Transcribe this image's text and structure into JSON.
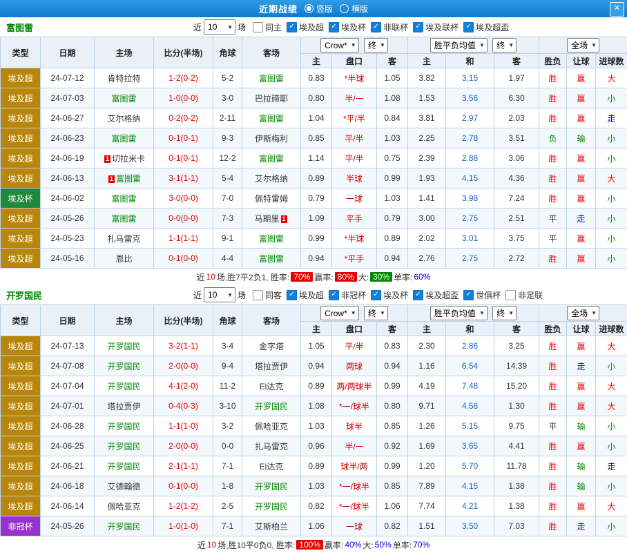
{
  "titlebar": {
    "title": "近期战绩",
    "layout_options": [
      {
        "label": "竖版",
        "selected": true
      },
      {
        "label": "横版",
        "selected": false
      }
    ],
    "close_label": "✕"
  },
  "table_header": {
    "cols": [
      "类型",
      "日期",
      "主场",
      "比分(半场)",
      "角球",
      "客场"
    ],
    "odds_dropdown": "Crow*",
    "odds_final_dropdown": "终",
    "odds_sub": [
      "主",
      "盘口",
      "客"
    ],
    "avg_dropdown": "胜平负均值",
    "avg_final_dropdown": "终",
    "avg_sub": [
      "主",
      "和",
      "客"
    ],
    "fullmatch_dropdown": "全场",
    "result_sub": [
      "胜负",
      "让球",
      "进球数"
    ]
  },
  "league_colors": {
    "埃及超": "#b8860b",
    "埃及杯": "#1e8a3c",
    "非冠杯": "#9932cc"
  },
  "value_colors": {
    "胜": "t-red",
    "负": "t-green",
    "平": "t-dark",
    "赢": "t-red",
    "输": "t-green",
    "走": "t-blue",
    "大": "t-red",
    "小": "t-green"
  },
  "sections": [
    {
      "team": "富图雷",
      "filter": {
        "near": "近",
        "count": "10",
        "unit": "场",
        "checkboxes": [
          {
            "label": "同主",
            "checked": false
          },
          {
            "label": "埃及超",
            "checked": true
          },
          {
            "label": "埃及杯",
            "checked": true
          },
          {
            "label": "非联杯",
            "checked": true
          },
          {
            "label": "埃及联杯",
            "checked": true
          },
          {
            "label": "埃及超盃",
            "checked": true
          }
        ]
      },
      "rows": [
        {
          "type": "埃及超",
          "date": "24-07-12",
          "home": {
            "name": "肯特拉特",
            "focus": false
          },
          "score": "1-2(0-2)",
          "corner": "5-2",
          "away": {
            "name": "富图雷",
            "focus": true
          },
          "odds": [
            "0.83",
            "*半球",
            "1.05"
          ],
          "avg": [
            "3.82",
            "3.15",
            "1.97"
          ],
          "result": [
            "胜",
            "赢",
            "大"
          ]
        },
        {
          "type": "埃及超",
          "date": "24-07-03",
          "home": {
            "name": "富图雷",
            "focus": true
          },
          "score": "1-0(0-0)",
          "corner": "3-0",
          "away": {
            "name": "巴拉碲耶",
            "focus": false
          },
          "odds": [
            "0.80",
            "半/一",
            "1.08"
          ],
          "avg": [
            "1.53",
            "3.56",
            "6.30"
          ],
          "result": [
            "胜",
            "赢",
            "小"
          ]
        },
        {
          "type": "埃及超",
          "date": "24-06-27",
          "home": {
            "name": "艾尔格纳",
            "focus": false
          },
          "score": "0-2(0-2)",
          "corner": "2-11",
          "away": {
            "name": "富图雷",
            "focus": true
          },
          "odds": [
            "1.04",
            "*平/半",
            "0.84"
          ],
          "avg": [
            "3.81",
            "2.97",
            "2.03"
          ],
          "result": [
            "胜",
            "赢",
            "走"
          ]
        },
        {
          "type": "埃及超",
          "date": "24-06-23",
          "home": {
            "name": "富图雷",
            "focus": true
          },
          "score": "0-1(0-1)",
          "corner": "9-3",
          "away": {
            "name": "伊斯梅利",
            "focus": false
          },
          "odds": [
            "0.85",
            "平/半",
            "1.03"
          ],
          "avg": [
            "2.25",
            "2.78",
            "3.51"
          ],
          "result": [
            "负",
            "输",
            "小"
          ]
        },
        {
          "type": "埃及超",
          "date": "24-06-19",
          "home": {
            "name": "切拉米卡",
            "focus": false,
            "badge": "1",
            "badge_pos": "left"
          },
          "score": "0-1(0-1)",
          "corner": "12-2",
          "away": {
            "name": "富图雷",
            "focus": true
          },
          "odds": [
            "1.14",
            "平/半",
            "0.75"
          ],
          "avg": [
            "2.39",
            "2.88",
            "3.06"
          ],
          "result": [
            "胜",
            "赢",
            "小"
          ]
        },
        {
          "type": "埃及超",
          "date": "24-06-13",
          "home": {
            "name": "富图雷",
            "focus": true,
            "badge": "1",
            "badge_pos": "left"
          },
          "score": "3-1(1-1)",
          "corner": "5-4",
          "away": {
            "name": "艾尔格纳",
            "focus": false
          },
          "odds": [
            "0.89",
            "半球",
            "0.99"
          ],
          "avg": [
            "1.93",
            "4.15",
            "4.36"
          ],
          "result": [
            "胜",
            "赢",
            "大"
          ]
        },
        {
          "type": "埃及杯",
          "date": "24-06-02",
          "home": {
            "name": "富图雷",
            "focus": true
          },
          "score": "3-0(0-0)",
          "corner": "7-0",
          "away": {
            "name": "佩特雷姆",
            "focus": false
          },
          "odds": [
            "0.79",
            "一球",
            "1.03"
          ],
          "avg": [
            "1.41",
            "3.98",
            "7.24"
          ],
          "result": [
            "胜",
            "赢",
            "小"
          ]
        },
        {
          "type": "埃及超",
          "date": "24-05-26",
          "home": {
            "name": "富图雷",
            "focus": true
          },
          "score": "0-0(0-0)",
          "corner": "7-3",
          "away": {
            "name": "马期里",
            "focus": false,
            "badge": "1",
            "badge_pos": "right"
          },
          "odds": [
            "1.09",
            "平手",
            "0.79"
          ],
          "avg": [
            "3.00",
            "2.75",
            "2.51"
          ],
          "result": [
            "平",
            "走",
            "小"
          ]
        },
        {
          "type": "埃及超",
          "date": "24-05-23",
          "home": {
            "name": "扎马雷克",
            "focus": false
          },
          "score": "1-1(1-1)",
          "corner": "9-1",
          "away": {
            "name": "富图雷",
            "focus": true
          },
          "odds": [
            "0.99",
            "*半球",
            "0.89"
          ],
          "avg": [
            "2.02",
            "3.01",
            "3.75"
          ],
          "result": [
            "平",
            "赢",
            "小"
          ]
        },
        {
          "type": "埃及超",
          "date": "24-05-16",
          "home": {
            "name": "恩比",
            "focus": false
          },
          "score": "0-1(0-0)",
          "corner": "4-4",
          "away": {
            "name": "富图雷",
            "focus": true
          },
          "odds": [
            "0.94",
            "*平手",
            "0.94"
          ],
          "avg": [
            "2.76",
            "2.75",
            "2.72"
          ],
          "result": [
            "胜",
            "赢",
            "小"
          ]
        }
      ],
      "summary": [
        {
          "t": "近",
          "c": ""
        },
        {
          "t": "10",
          "c": "t-red"
        },
        {
          "t": "场,胜7平2负1, 胜率: ",
          "c": ""
        },
        {
          "t": "70%",
          "c": "badge badge-red"
        },
        {
          "t": " 赢率: ",
          "c": ""
        },
        {
          "t": "80%",
          "c": "badge badge-red"
        },
        {
          "t": " 大: ",
          "c": ""
        },
        {
          "t": "30%",
          "c": "badge badge-green"
        },
        {
          "t": " 单率:",
          "c": ""
        },
        {
          "t": "60%",
          "c": "t-blue"
        }
      ]
    },
    {
      "team": "开罗国民",
      "filter": {
        "near": "近",
        "count": "10",
        "unit": "场",
        "checkboxes": [
          {
            "label": "同客",
            "checked": false
          },
          {
            "label": "埃及超",
            "checked": true
          },
          {
            "label": "非冠杯",
            "checked": true
          },
          {
            "label": "埃及杯",
            "checked": true
          },
          {
            "label": "埃及超盃",
            "checked": true
          },
          {
            "label": "世俱杯",
            "checked": true
          },
          {
            "label": "非足联",
            "checked": false
          }
        ]
      },
      "rows": [
        {
          "type": "埃及超",
          "date": "24-07-13",
          "home": {
            "name": "开罗国民",
            "focus": true
          },
          "score": "3-2(1-1)",
          "corner": "3-4",
          "away": {
            "name": "金字塔",
            "focus": false
          },
          "odds": [
            "1.05",
            "平/半",
            "0.83"
          ],
          "avg": [
            "2.30",
            "2.86",
            "3.25"
          ],
          "result": [
            "胜",
            "赢",
            "大"
          ]
        },
        {
          "type": "埃及超",
          "date": "24-07-08",
          "home": {
            "name": "开罗国民",
            "focus": true
          },
          "score": "2-0(0-0)",
          "corner": "9-4",
          "away": {
            "name": "塔拉贾伊",
            "focus": false
          },
          "odds": [
            "0.94",
            "两球",
            "0.94"
          ],
          "avg": [
            "1.16",
            "6.54",
            "14.39"
          ],
          "result": [
            "胜",
            "走",
            "小"
          ]
        },
        {
          "type": "埃及超",
          "date": "24-07-04",
          "home": {
            "name": "开罗国民",
            "focus": true
          },
          "score": "4-1(2-0)",
          "corner": "11-2",
          "away": {
            "name": "El达克",
            "focus": false
          },
          "odds": [
            "0.89",
            "两/两球半",
            "0.99"
          ],
          "avg": [
            "4.19",
            "7.48",
            "15.20"
          ],
          "result": [
            "胜",
            "赢",
            "大"
          ]
        },
        {
          "type": "埃及超",
          "date": "24-07-01",
          "home": {
            "name": "塔拉贾伊",
            "focus": false
          },
          "score": "0-4(0-3)",
          "corner": "3-10",
          "away": {
            "name": "开罗国民",
            "focus": true
          },
          "odds": [
            "1.08",
            "*一/球半",
            "0.80"
          ],
          "avg": [
            "9.71",
            "4.58",
            "1.30"
          ],
          "result": [
            "胜",
            "赢",
            "大"
          ]
        },
        {
          "type": "埃及超",
          "date": "24-06-28",
          "home": {
            "name": "开罗国民",
            "focus": true
          },
          "score": "1-1(1-0)",
          "corner": "3-2",
          "away": {
            "name": "佩哈亚克",
            "focus": false
          },
          "odds": [
            "1.03",
            "球半",
            "0.85"
          ],
          "avg": [
            "1.26",
            "5.15",
            "9.75"
          ],
          "result": [
            "平",
            "输",
            "小"
          ]
        },
        {
          "type": "埃及超",
          "date": "24-06-25",
          "home": {
            "name": "开罗国民",
            "focus": true
          },
          "score": "2-0(0-0)",
          "corner": "0-0",
          "away": {
            "name": "扎马雷克",
            "focus": false
          },
          "odds": [
            "0.96",
            "半/一",
            "0.92"
          ],
          "avg": [
            "1.69",
            "3.65",
            "4.41"
          ],
          "result": [
            "胜",
            "赢",
            "小"
          ]
        },
        {
          "type": "埃及超",
          "date": "24-06-21",
          "home": {
            "name": "开罗国民",
            "focus": true
          },
          "score": "2-1(1-1)",
          "corner": "7-1",
          "away": {
            "name": "El达克",
            "focus": false
          },
          "odds": [
            "0.89",
            "球半/两",
            "0.99"
          ],
          "avg": [
            "1.20",
            "5.70",
            "11.78"
          ],
          "result": [
            "胜",
            "输",
            "走"
          ]
        },
        {
          "type": "埃及超",
          "date": "24-06-18",
          "home": {
            "name": "艾德翰德",
            "focus": false
          },
          "score": "0-1(0-0)",
          "corner": "1-8",
          "away": {
            "name": "开罗国民",
            "focus": true
          },
          "odds": [
            "1.03",
            "*一/球半",
            "0.85"
          ],
          "avg": [
            "7.89",
            "4.15",
            "1.38"
          ],
          "result": [
            "胜",
            "输",
            "小"
          ]
        },
        {
          "type": "埃及超",
          "date": "24-06-14",
          "home": {
            "name": "佩哈亚克",
            "focus": false
          },
          "score": "1-2(1-2)",
          "corner": "2-5",
          "away": {
            "name": "开罗国民",
            "focus": true
          },
          "odds": [
            "0.82",
            "*一/球半",
            "1.06"
          ],
          "avg": [
            "7.74",
            "4.21",
            "1.38"
          ],
          "result": [
            "胜",
            "赢",
            "大"
          ]
        },
        {
          "type": "非冠杯",
          "date": "24-05-26",
          "home": {
            "name": "开罗国民",
            "focus": true
          },
          "score": "1-0(1-0)",
          "corner": "7-1",
          "away": {
            "name": "艾斯柏兰",
            "focus": false
          },
          "odds": [
            "1.06",
            "一球",
            "0.82"
          ],
          "avg": [
            "1.51",
            "3.50",
            "7.03"
          ],
          "result": [
            "胜",
            "走",
            "小"
          ]
        }
      ],
      "summary": [
        {
          "t": "近",
          "c": ""
        },
        {
          "t": "10",
          "c": "t-red"
        },
        {
          "t": "场,胜10平0负0, 胜率: ",
          "c": ""
        },
        {
          "t": "100%",
          "c": "badge badge-red"
        },
        {
          "t": " 赢率:",
          "c": ""
        },
        {
          "t": "40%",
          "c": "t-blue"
        },
        {
          "t": " 大:",
          "c": ""
        },
        {
          "t": "50%",
          "c": "t-blue"
        },
        {
          "t": " 单率:",
          "c": ""
        },
        {
          "t": "70%",
          "c": "t-blue"
        }
      ]
    }
  ]
}
